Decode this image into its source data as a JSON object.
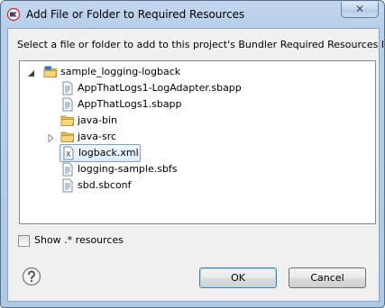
{
  "window": {
    "title": "Add File or Folder to Required Resources",
    "close_glyph": "✕"
  },
  "message": "Select a file or folder to add to this project's Bundler Required Resources list",
  "tree": {
    "root": {
      "label": "sample_logging-logback",
      "icon": "project-folder-icon",
      "expanded": true
    },
    "items": [
      {
        "label": "AppThatLogs1-LogAdapter.sbapp",
        "icon": "file-icon"
      },
      {
        "label": "AppThatLogs1.sbapp",
        "icon": "file-icon"
      },
      {
        "label": "java-bin",
        "icon": "folder-icon"
      },
      {
        "label": "java-src",
        "icon": "folder-icon",
        "expandable": true
      },
      {
        "label": "logback.xml",
        "icon": "xml-file-icon",
        "selected": true
      },
      {
        "label": "logging-sample.sbfs",
        "icon": "file-icon"
      },
      {
        "label": "sbd.sbconf",
        "icon": "file-icon"
      }
    ]
  },
  "show_resources": {
    "label": "Show .* resources",
    "checked": false
  },
  "buttons": {
    "ok": "OK",
    "cancel": "Cancel"
  },
  "colors": {
    "accent": "#3c7fb1",
    "folder": "#e9b84a",
    "selection": "#dcebfc"
  }
}
